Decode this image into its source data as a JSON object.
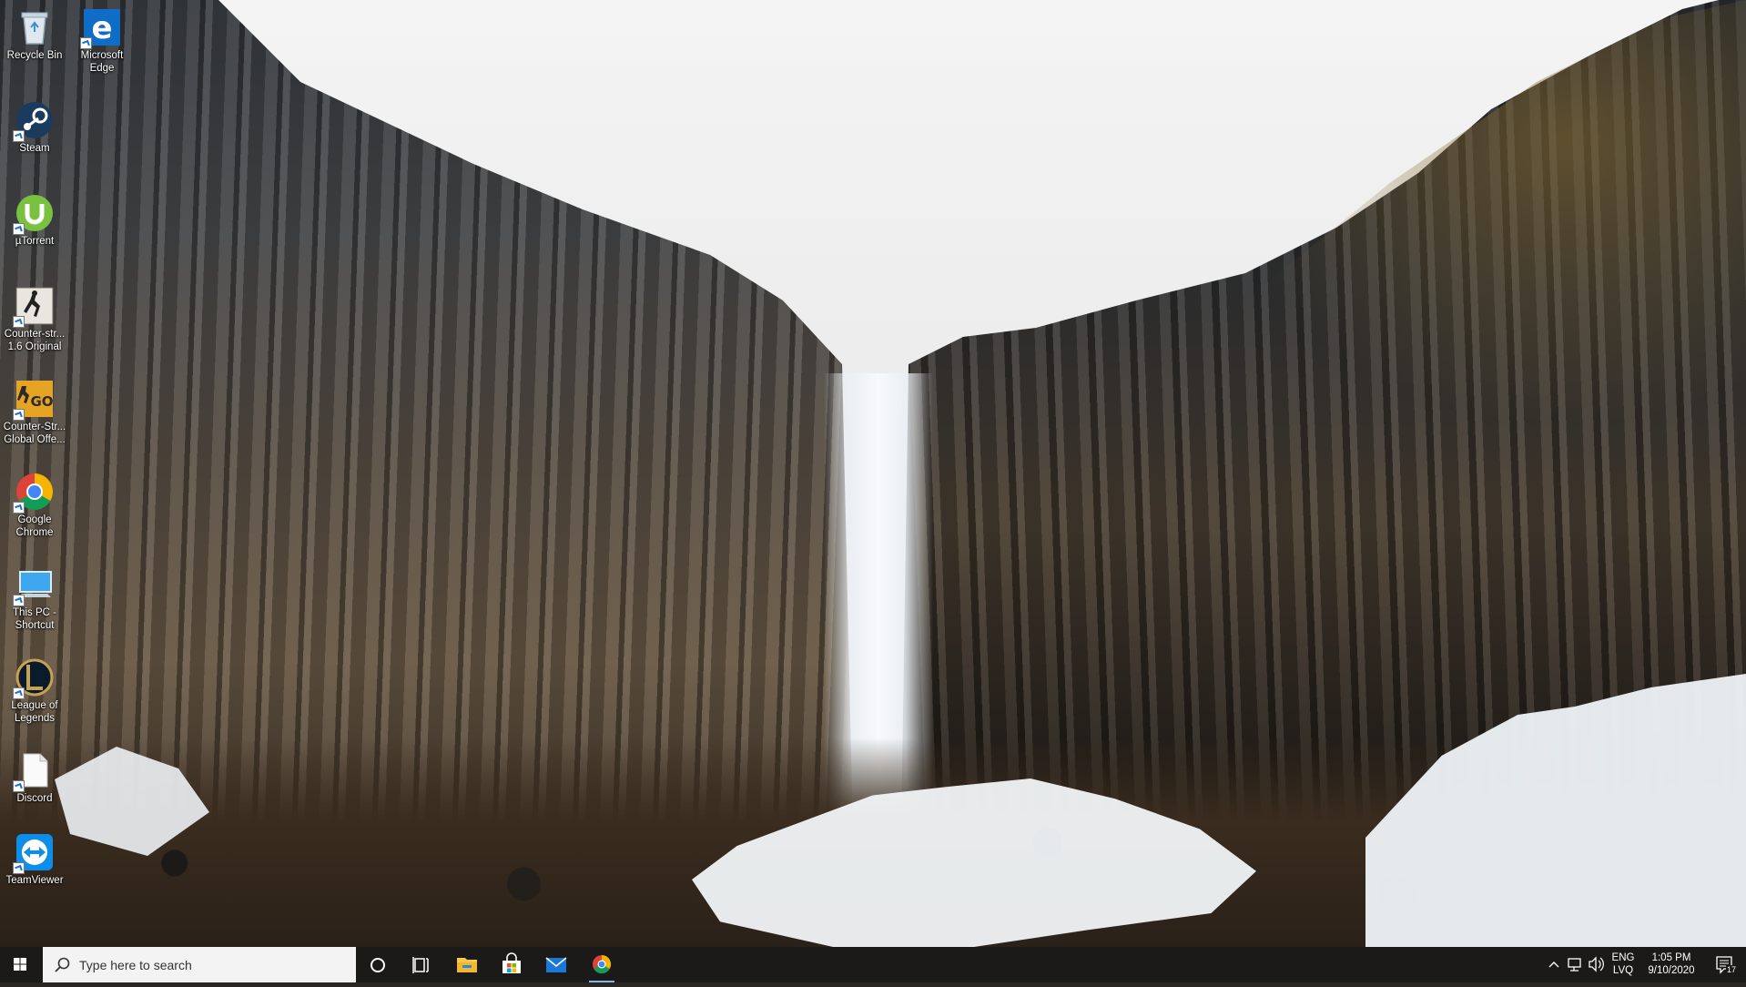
{
  "desktop": {
    "icons": [
      {
        "label": "Recycle Bin",
        "icon": "recycle-bin-icon"
      },
      {
        "label": "Microsoft Edge",
        "icon": "edge-icon"
      },
      {
        "label": "Steam",
        "icon": "steam-icon"
      },
      {
        "label": "µTorrent",
        "icon": "utorrent-icon"
      },
      {
        "label": "Counter-str... 1.6 Original",
        "icon": "counter-strike-icon"
      },
      {
        "label": "Counter-Str... Global Offe...",
        "icon": "csgo-icon"
      },
      {
        "label": "Google Chrome",
        "icon": "chrome-icon"
      },
      {
        "label": "This PC - Shortcut",
        "icon": "this-pc-icon"
      },
      {
        "label": "League of Legends",
        "icon": "league-of-legends-icon"
      },
      {
        "label": "Discord",
        "icon": "file-icon"
      },
      {
        "label": "TeamViewer",
        "icon": "teamviewer-icon"
      }
    ]
  },
  "taskbar": {
    "search_placeholder": "Type here to search",
    "pinned": [
      {
        "name": "cortana-icon"
      },
      {
        "name": "task-view-icon"
      },
      {
        "name": "file-explorer-icon"
      },
      {
        "name": "microsoft-store-icon"
      },
      {
        "name": "mail-icon"
      },
      {
        "name": "chrome-icon",
        "active": true
      }
    ],
    "tray": {
      "language_top": "ENG",
      "language_bottom": "LVQ",
      "time": "1:05 PM",
      "date": "9/10/2020",
      "notification_count": "17"
    },
    "accent_color": "#76b9ed"
  }
}
